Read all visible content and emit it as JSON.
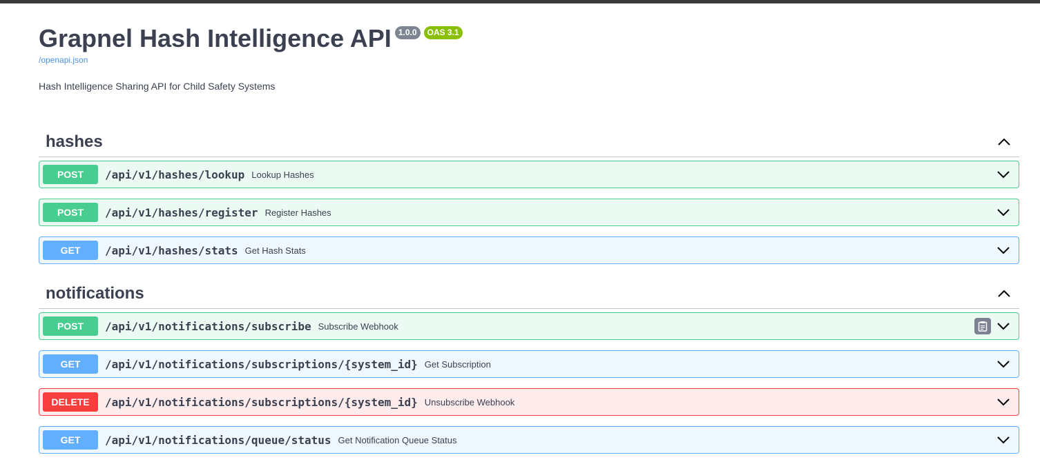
{
  "info": {
    "title": "Grapnel Hash Intelligence API",
    "version": "1.0.0",
    "oas": "OAS 3.1",
    "spec_link": "/openapi.json",
    "description": "Hash Intelligence Sharing API for Child Safety Systems"
  },
  "tags": [
    {
      "name": "hashes",
      "operations": [
        {
          "method": "POST",
          "path": "/api/v1/hashes/lookup",
          "summary": "Lookup Hashes"
        },
        {
          "method": "POST",
          "path": "/api/v1/hashes/register",
          "summary": "Register Hashes"
        },
        {
          "method": "GET",
          "path": "/api/v1/hashes/stats",
          "summary": "Get Hash Stats"
        }
      ]
    },
    {
      "name": "notifications",
      "operations": [
        {
          "method": "POST",
          "path": "/api/v1/notifications/subscribe",
          "summary": "Subscribe Webhook"
        },
        {
          "method": "GET",
          "path": "/api/v1/notifications/subscriptions/{system_id}",
          "summary": "Get Subscription"
        },
        {
          "method": "DELETE",
          "path": "/api/v1/notifications/subscriptions/{system_id}",
          "summary": "Unsubscribe Webhook"
        },
        {
          "method": "GET",
          "path": "/api/v1/notifications/queue/status",
          "summary": "Get Notification Queue Status"
        }
      ]
    }
  ],
  "colors": {
    "post": "#49cc90",
    "get": "#61affe",
    "delete": "#f93e3e",
    "version_badge": "#7d8492",
    "oas_badge": "#89bf04",
    "link": "#4990e2"
  },
  "icons": {
    "tag_toggle": "chevron-up-icon",
    "op_toggle": "chevron-down-icon",
    "copy": "clipboard-icon"
  }
}
